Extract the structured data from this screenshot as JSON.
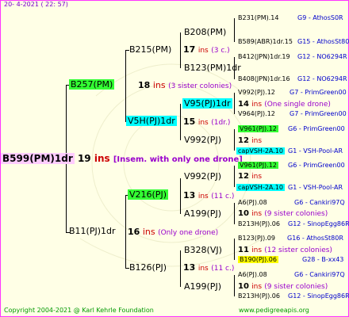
{
  "header": {
    "date": "20-   4-2021  ( 22: 57)"
  },
  "footer": {
    "copyright": "Copyright 2004-2021 @ Karl Kehrle Foundation",
    "url": "www.pedigreeapis.org"
  },
  "root": {
    "name": "B599(PM)1dr",
    "num": "19",
    "ins": "ins",
    "note": "[Insem. with only one drone]"
  },
  "gen1": {
    "upper": {
      "name": "B257(PM)",
      "num": "18",
      "ins": "ins",
      "note": "(3 sister colonies)"
    },
    "lower": {
      "name": "B11(PJ)1dr",
      "num": "16",
      "ins": "ins",
      "note": "(Only one drone)"
    }
  },
  "gen2": {
    "b215": {
      "name": "B215(PM)",
      "num": "17",
      "ins": "ins",
      "note": "(3 c.)"
    },
    "v5h": {
      "name": "V5H(PJ)1dr",
      "num": "15",
      "ins": "ins",
      "note": "(1dr.)"
    },
    "v216": {
      "name": "V216(PJ)",
      "num": "13",
      "ins": "ins",
      "note": "(11 c.)"
    },
    "b126": {
      "name": "B126(PJ)",
      "num": "13",
      "ins": "ins",
      "note": "(11 c.)"
    }
  },
  "gen3": {
    "b208": {
      "name": "B208(PM)"
    },
    "b123": {
      "name": "B123(PM)1dr"
    },
    "v95": {
      "name": "V95(PJ)1dr",
      "num": "14",
      "ins": "ins",
      "note": "(One single drone)"
    },
    "v992a": {
      "name": "V992(PJ)",
      "num": "12",
      "ins": "ins"
    },
    "v992b": {
      "name": "V992(PJ)",
      "num": "12",
      "ins": "ins"
    },
    "a199a": {
      "name": "A199(PJ)",
      "num": "10",
      "ins": "ins",
      "note": "(9 sister colonies)"
    },
    "b328": {
      "name": "B328(VJ)",
      "num": "11",
      "ins": "ins",
      "note": "(12 sister colonies)"
    },
    "a199b": {
      "name": "A199(PJ)",
      "num": "10",
      "ins": "ins",
      "note": "(9 sister colonies)"
    }
  },
  "gen4": [
    {
      "name": "B231(PM).14",
      "tail": "G9 - AthosS0R"
    },
    {
      "name": "B589(ABR)1dr.15",
      "tail": "G15 - AthosSt80R"
    },
    {
      "name": "B412(JPN)1dr.19",
      "tail": "G12 - NO6294R"
    },
    {
      "name": "B408(JPN)1dr.16",
      "tail": "G12 - NO6294R"
    },
    {
      "name": "V992(PJ).12",
      "tail": "G7 - PrimGreen00"
    },
    {
      "name": "V964(PJ).12",
      "tail": "G7 - PrimGreen00"
    },
    {
      "name": "V961(PJ).12",
      "tail": "G6 - PrimGreen00"
    },
    {
      "name": "capVSH-2A.10",
      "tail": "G1 - VSH-Pool-AR"
    },
    {
      "name": "V961(PJ).12",
      "tail": "G6 - PrimGreen00"
    },
    {
      "name": "capVSH-2A.10",
      "tail": "G1 - VSH-Pool-AR"
    },
    {
      "name": "A6(PJ).08",
      "tail": "G6 - Cankiri97Q"
    },
    {
      "name": "B213H(PJ).06",
      "tail": "G12 - SinopEgg86R"
    },
    {
      "name": "B123(PJ).09",
      "tail": "G16 - AthosSt80R"
    },
    {
      "name": "B190(PJ).06",
      "tail": "G28 - B-xx43"
    },
    {
      "name": "A6(PJ).08",
      "tail": "G6 - Cankiri97Q"
    },
    {
      "name": "B213H(PJ).06",
      "tail": "G12 - SinopEgg86R"
    }
  ],
  "colors": {
    "green": "#33ff33",
    "cyan": "#00ffff",
    "yellow": "#ffff00",
    "pink": "#ffccff",
    "ins": "#cc0000",
    "note": "#9900cc",
    "tail": "#0000cc"
  }
}
